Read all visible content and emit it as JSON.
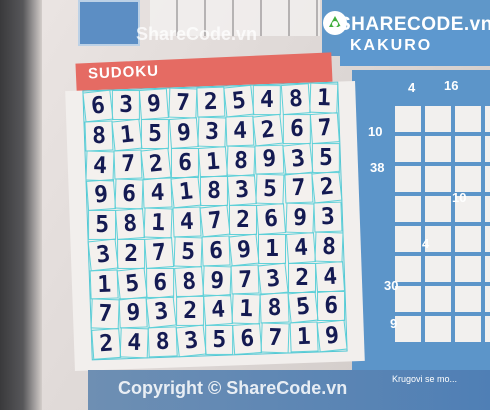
{
  "watermark": "ShareCode.vn",
  "watermark_copyright": "Copyright © ShareCode.vn",
  "brand": "SHARECODE.vn",
  "sudoku_title": "SUDOKU",
  "kakuro_title": "KAKURO",
  "kakuro_clues": [
    "4",
    "16",
    "10",
    "38",
    "10",
    "4",
    "30",
    "9"
  ],
  "footer_text": "Krugovi se mo...",
  "sudoku_grid": [
    [
      "6",
      "3",
      "9",
      "7",
      "2",
      "5",
      "4",
      "8",
      "1"
    ],
    [
      "8",
      "1",
      "5",
      "9",
      "3",
      "4",
      "2",
      "6",
      "7"
    ],
    [
      "4",
      "7",
      "2",
      "6",
      "1",
      "8",
      "9",
      "3",
      "5"
    ],
    [
      "9",
      "6",
      "4",
      "1",
      "8",
      "3",
      "5",
      "7",
      "2"
    ],
    [
      "5",
      "8",
      "1",
      "4",
      "7",
      "2",
      "6",
      "9",
      "3"
    ],
    [
      "3",
      "2",
      "7",
      "5",
      "6",
      "9",
      "1",
      "4",
      "8"
    ],
    [
      "1",
      "5",
      "6",
      "8",
      "9",
      "7",
      "3",
      "2",
      "4"
    ],
    [
      "7",
      "9",
      "3",
      "2",
      "4",
      "1",
      "8",
      "5",
      "6"
    ],
    [
      "2",
      "4",
      "8",
      "3",
      "5",
      "6",
      "7",
      "1",
      "9"
    ]
  ],
  "colors": {
    "ink": "#141a52",
    "grid_line": "#5fd0d8",
    "sudoku_header": "#e56b63",
    "kakuro_blue": "#5c95c9"
  }
}
